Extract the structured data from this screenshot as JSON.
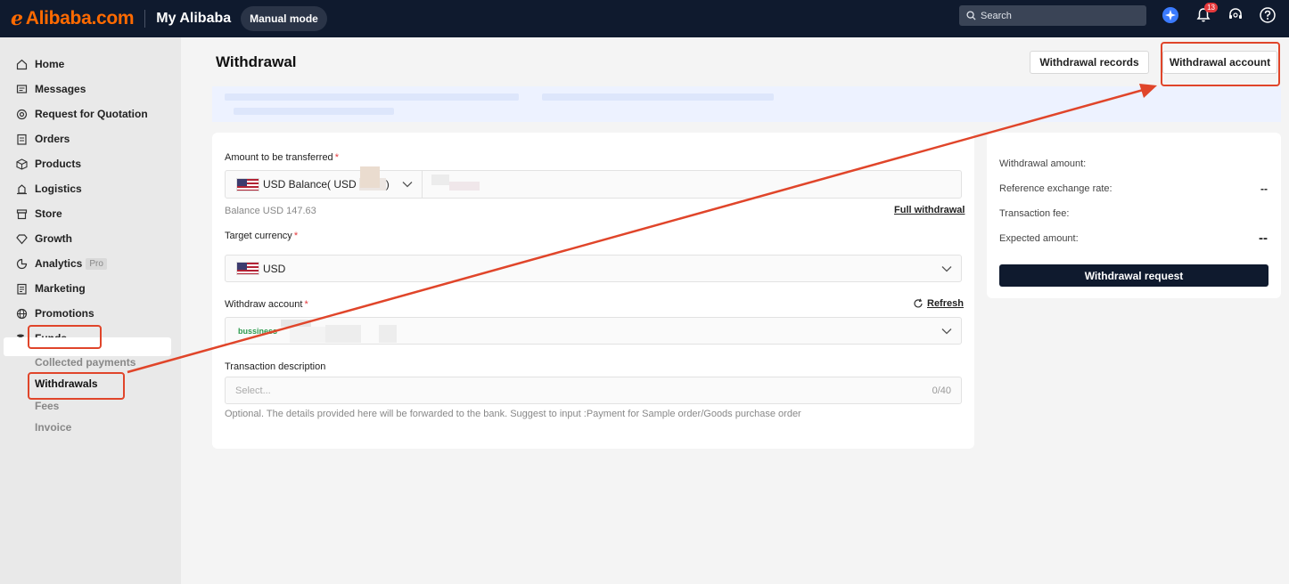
{
  "header": {
    "logo_text": "Alibaba.com",
    "title": "My Alibaba",
    "mode_label": "Manual mode",
    "search_placeholder": "Search",
    "notification_count": "13"
  },
  "sidebar": {
    "items": [
      {
        "label": "Home",
        "icon": "home-icon"
      },
      {
        "label": "Messages",
        "icon": "messages-icon"
      },
      {
        "label": "Request for Quotation",
        "icon": "target-icon"
      },
      {
        "label": "Orders",
        "icon": "clipboard-icon"
      },
      {
        "label": "Products",
        "icon": "box-icon"
      },
      {
        "label": "Logistics",
        "icon": "truck-icon"
      },
      {
        "label": "Store",
        "icon": "store-icon"
      },
      {
        "label": "Growth",
        "icon": "diamond-icon"
      },
      {
        "label": "Analytics",
        "icon": "chart-icon",
        "tag": "Pro"
      },
      {
        "label": "Marketing",
        "icon": "document-icon"
      },
      {
        "label": "Promotions",
        "icon": "globe-icon"
      },
      {
        "label": "Funds",
        "icon": "coins-icon"
      }
    ],
    "funds_sub": [
      {
        "label": "Collected payments"
      },
      {
        "label": "Withdrawals",
        "active": true
      },
      {
        "label": "Fees"
      },
      {
        "label": "Invoice"
      }
    ]
  },
  "main": {
    "title": "Withdrawal",
    "records_button": "Withdrawal records",
    "account_button": "Withdrawal account",
    "form": {
      "amount_label": "Amount to be transferred",
      "amount_source": "USD Balance( USD",
      "amount_source_suffix": ")",
      "balance_text": "Balance USD 147.63",
      "full_withdrawal": "Full withdrawal",
      "currency_label": "Target currency",
      "currency_value": "USD",
      "account_label": "Withdraw account",
      "refresh_label": "Refresh",
      "account_tag": "bussiness",
      "description_label": "Transaction description",
      "description_placeholder": "Select...",
      "description_count": "0/40",
      "description_hint": "Optional. The details provided here will be forwarded to the bank. Suggest to input :Payment for Sample order/Goods purchase order"
    },
    "summary": {
      "withdrawal_amount_label": "Withdrawal amount:",
      "exchange_rate_label": "Reference exchange rate:",
      "exchange_rate_value": "--",
      "fee_label": "Transaction fee:",
      "expected_label": "Expected amount:",
      "expected_value": "--",
      "submit_button": "Withdrawal request"
    }
  },
  "colors": {
    "brand_orange": "#ff6a00",
    "header_bg": "#0f1a2e",
    "annotation_red": "#e0452a",
    "required_red": "#e4393c"
  }
}
